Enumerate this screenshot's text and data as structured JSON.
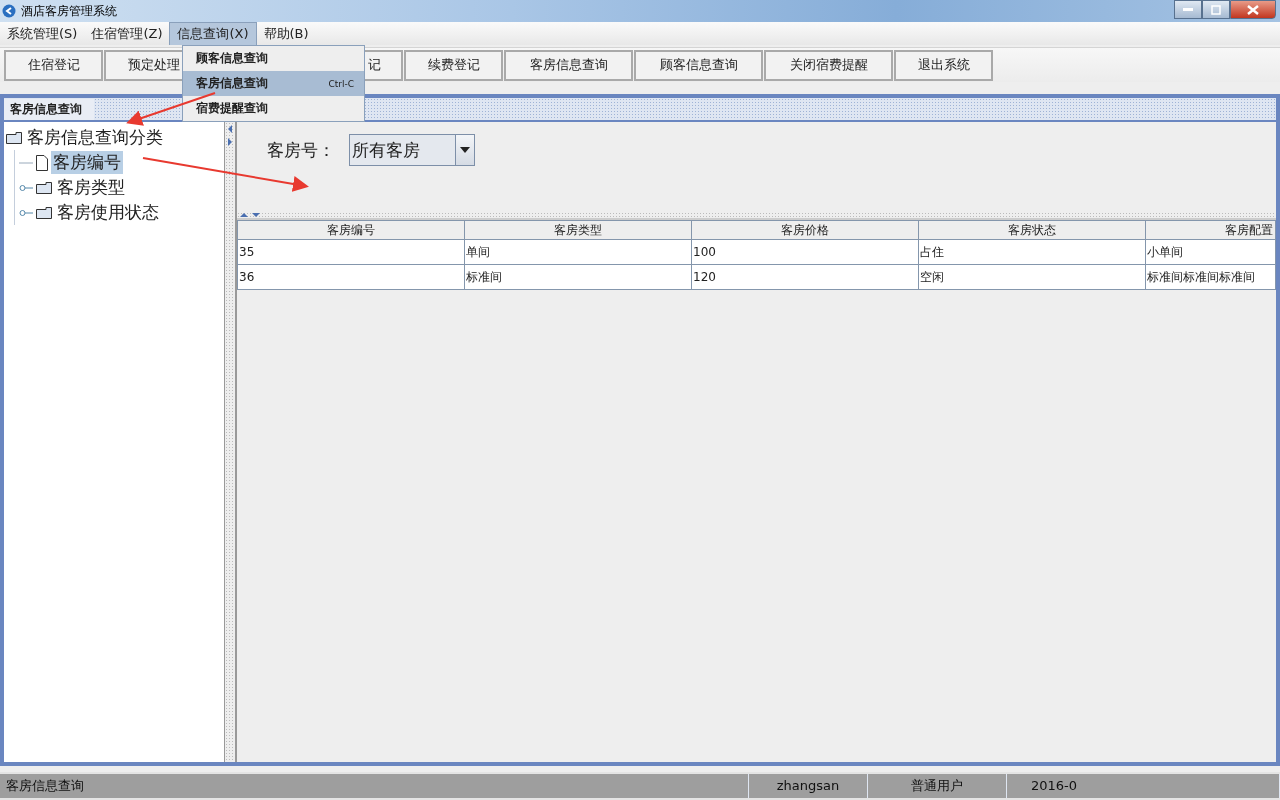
{
  "window": {
    "title": "酒店客房管理系统"
  },
  "menubar": [
    {
      "label": "系统管理(S)",
      "selected": false
    },
    {
      "label": "住宿管理(Z)",
      "selected": false
    },
    {
      "label": "信息查询(X)",
      "selected": true
    },
    {
      "label": "帮助(B)",
      "selected": false
    }
  ],
  "open_menu": {
    "items": [
      {
        "label": "顾客信息查询",
        "selected": false
      },
      {
        "label": "客房信息查询",
        "shortcut": "Ctrl-C",
        "selected": true
      },
      {
        "label": "宿费提醒查询",
        "selected": false
      }
    ]
  },
  "toolbar": [
    {
      "label": "住宿登记",
      "kind": "full"
    },
    {
      "label": "预定处理",
      "kind": "full"
    },
    {
      "label": "记",
      "kind": "covered"
    },
    {
      "label": "续费登记",
      "kind": "full"
    },
    {
      "label": "客房信息查询",
      "kind": "wide"
    },
    {
      "label": "顾客信息查询",
      "kind": "wide"
    },
    {
      "label": "关闭宿费提醒",
      "kind": "wide"
    },
    {
      "label": "退出系统",
      "kind": "full"
    }
  ],
  "internal_frame": {
    "title": "客房信息查询"
  },
  "tree": {
    "label": "客房信息查询分类",
    "expanded": true,
    "children": [
      {
        "label": "客房编号",
        "kind": "leaf",
        "selected": true
      },
      {
        "label": "客房类型",
        "kind": "folder",
        "expanded": false,
        "selected": false
      },
      {
        "label": "客房使用状态",
        "kind": "folder",
        "expanded": false,
        "selected": false
      }
    ]
  },
  "filter": {
    "label": "客房号：",
    "value": "所有客房"
  },
  "table": {
    "columns": [
      "客房编号",
      "客房类型",
      "客房价格",
      "客房状态",
      "客房配置"
    ],
    "rows": [
      [
        "35",
        "单间",
        "100",
        "占住",
        "小单间"
      ],
      [
        "36",
        "标准间",
        "120",
        "空闲",
        "标准间标准间标准间"
      ]
    ]
  },
  "status_bar": [
    "客房信息查询",
    "zhangsan",
    "普通用户",
    "2016-0"
  ]
}
